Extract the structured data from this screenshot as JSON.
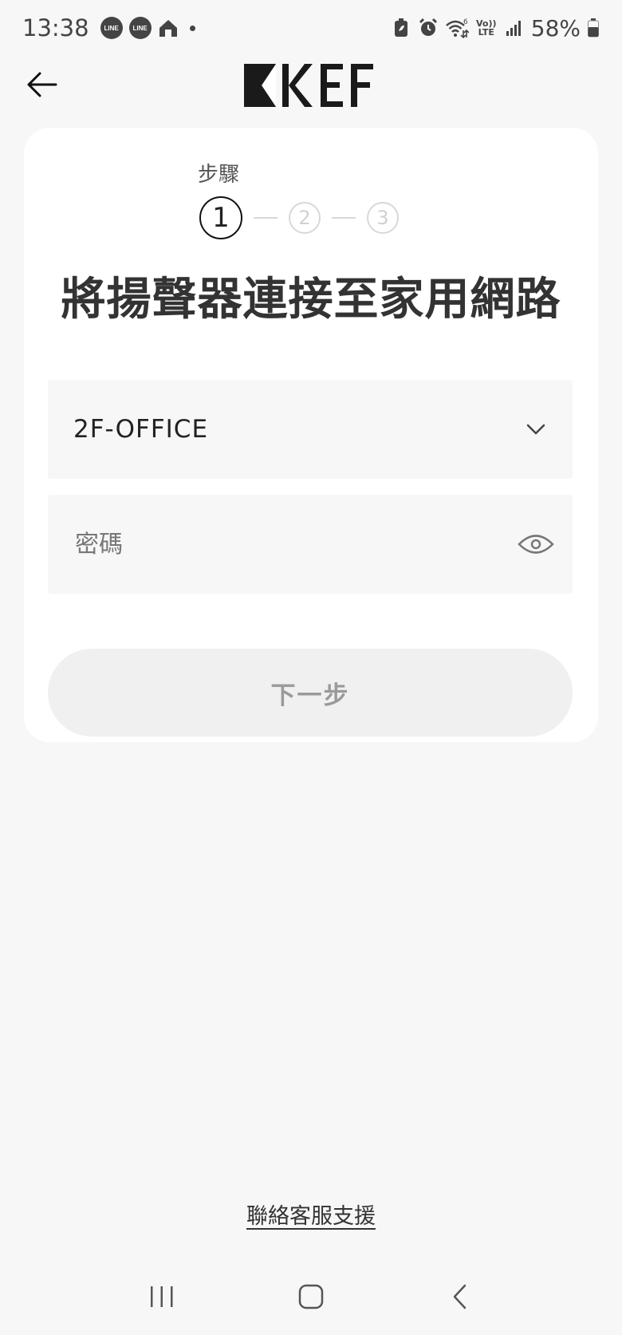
{
  "status_bar": {
    "time": "13:38",
    "notification_apps": [
      "LINE",
      "LINE"
    ],
    "volte_line1": "Vo))",
    "volte_line2": "LTE",
    "wifi_gen": "6",
    "battery_percent": "58%"
  },
  "header": {
    "logo_text": "KEF",
    "back_icon": "arrow-left-icon"
  },
  "setup": {
    "steps_label": "步驟",
    "steps": [
      {
        "number": "1",
        "state": "active"
      },
      {
        "number": "2",
        "state": "inactive"
      },
      {
        "number": "3",
        "state": "inactive"
      }
    ],
    "title": "將揚聲器連接至家用網路",
    "network_field": {
      "value": "2F-OFFICE",
      "icon": "chevron-down-icon"
    },
    "password_field": {
      "placeholder": "密碼",
      "icon": "eye-icon"
    },
    "next_button_label": "下一步"
  },
  "support": {
    "link_label": "聯絡客服支援"
  },
  "nav_bar": {
    "items": [
      "recent-apps-icon",
      "home-icon",
      "back-icon"
    ]
  },
  "colors": {
    "background": "#f7f7f7",
    "card": "#ffffff",
    "button_disabled_bg": "#f0f0f0",
    "button_disabled_text": "#9a9a9a",
    "step_active": "#111111",
    "step_inactive": "#d8d8d8"
  }
}
